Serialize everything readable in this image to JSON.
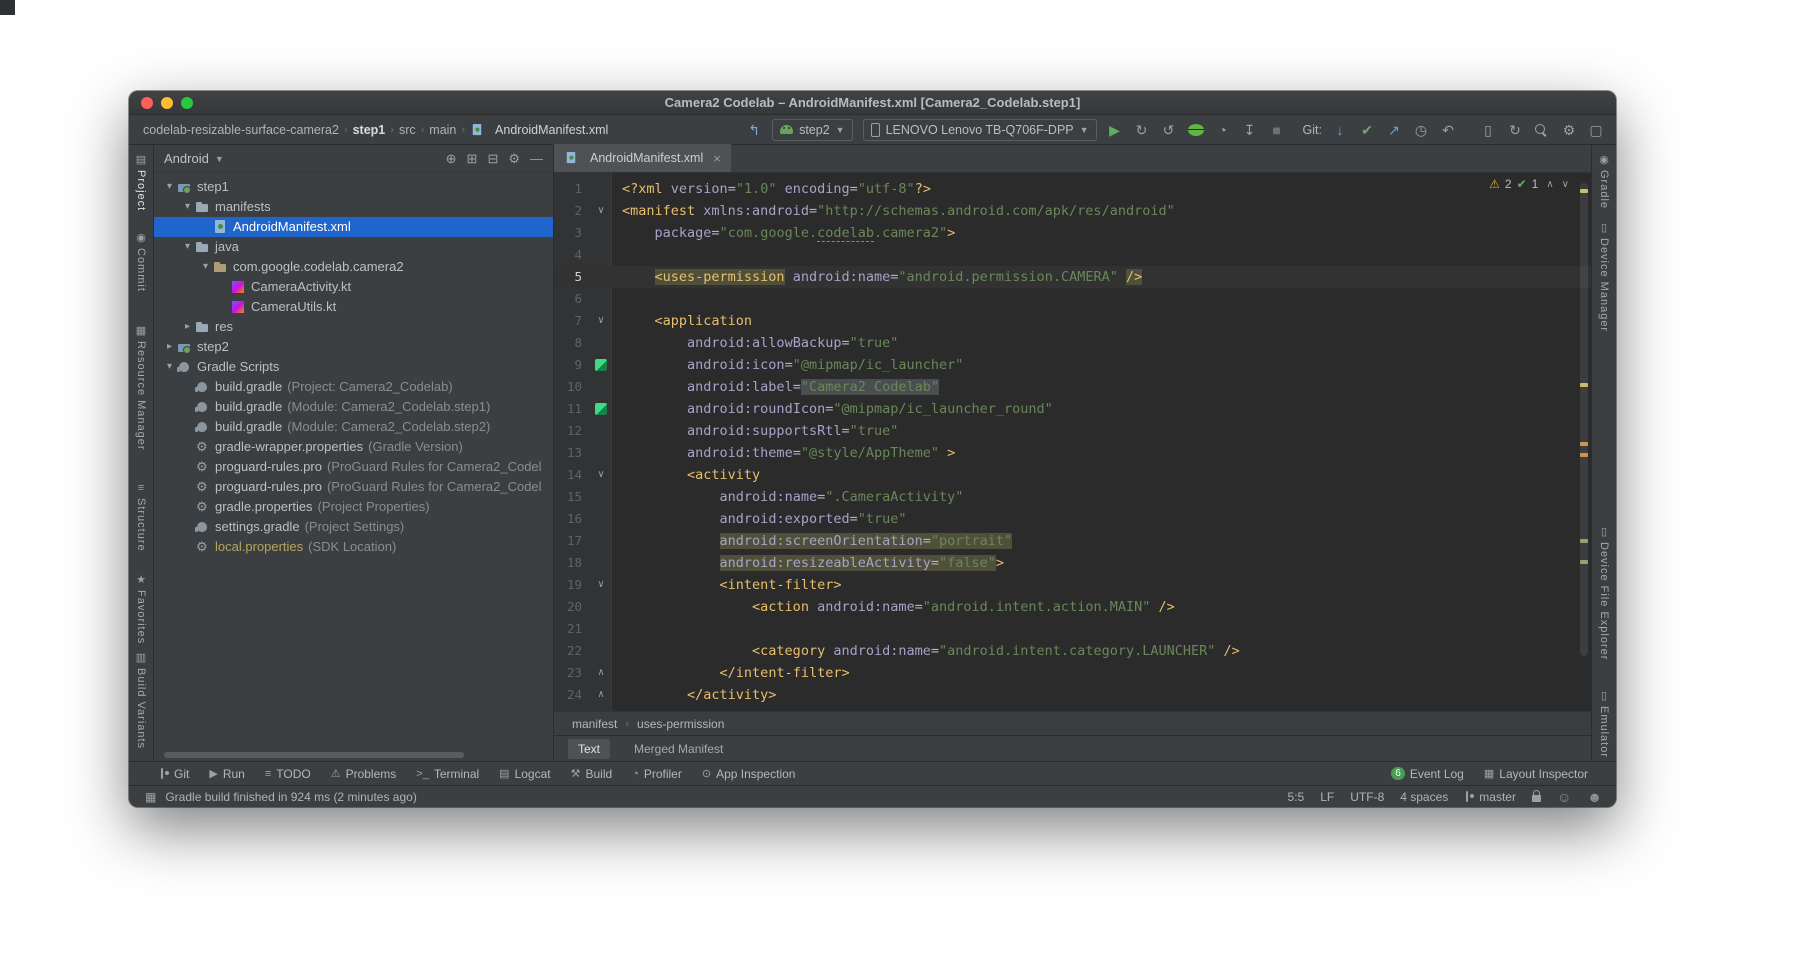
{
  "window": {
    "title": "Camera2 Codelab – AndroidManifest.xml [Camera2_Codelab.step1]"
  },
  "toolbar": {
    "breadcrumbs": [
      {
        "label": "codelab-resizable-surface-camera2"
      },
      {
        "label": "step1",
        "bold": true
      },
      {
        "label": "src"
      },
      {
        "label": "main"
      },
      {
        "label": "AndroidManifest.xml",
        "icon": "manifest",
        "bright": true
      }
    ],
    "back_icon": {
      "name": "back-arrow-icon",
      "glyph": "↰",
      "color": "#7da7d9"
    },
    "run_config": {
      "label": "step2"
    },
    "device": {
      "label": "LENOVO Lenovo TB-Q706F-DPP"
    },
    "run_icons": [
      {
        "name": "run-button",
        "glyph": "▶",
        "color": "#5fad65"
      },
      {
        "name": "apply-changes-button",
        "glyph": "↻",
        "color": "#9da0a3"
      },
      {
        "name": "apply-code-changes-button",
        "glyph": "↺",
        "color": "#9da0a3"
      },
      {
        "name": "debug-button",
        "css": "css-bug"
      },
      {
        "name": "profiler-button",
        "glyph": "◔",
        "color": "#9da0a3"
      },
      {
        "name": "attach-debugger-button",
        "glyph": "↧",
        "color": "#9da0a3"
      },
      {
        "name": "stop-button",
        "glyph": "■",
        "color": "#6e7173"
      }
    ],
    "git_label": "Git:",
    "git_icons": [
      {
        "name": "update-project-button",
        "glyph": "↓",
        "color": "#6a9fd8"
      },
      {
        "name": "commit-button",
        "glyph": "✔",
        "color": "#76a277"
      },
      {
        "name": "push-button",
        "glyph": "↗",
        "color": "#6a9fd8"
      },
      {
        "name": "history-button",
        "glyph": "◷",
        "color": "#9da0a3"
      },
      {
        "name": "rollback-button",
        "glyph": "↶",
        "color": "#9da0a3"
      }
    ],
    "right_icons": [
      {
        "name": "device-manager-icon",
        "glyph": "▯",
        "color": "#9da0a3"
      },
      {
        "name": "gradle-sync-icon",
        "glyph": "↻",
        "color": "#9da0a3"
      },
      {
        "name": "search-icon",
        "css": "css-search"
      },
      {
        "name": "settings-icon",
        "glyph": "⚙",
        "color": "#9da0a3"
      },
      {
        "name": "window-layout-icon",
        "glyph": "▢",
        "color": "#9da0a3"
      }
    ]
  },
  "left_stripe": {
    "items": [
      {
        "name": "project",
        "label": "Project",
        "icon": "▤",
        "active": true,
        "gap": 10
      },
      {
        "name": "commit",
        "label": "Commit",
        "icon": "◉",
        "gap": 22
      },
      {
        "name": "resource-manager",
        "label": "Resource Manager",
        "icon": "▦",
        "gap": 34
      },
      {
        "name": "structure",
        "label": "Structure",
        "icon": "≡",
        "gap": 32
      },
      {
        "name": "favorites",
        "label": "Favorites",
        "icon": "★",
        "gap": 24
      },
      {
        "name": "build-variants",
        "label": "Build Variants",
        "icon": "▥",
        "gap": 8
      }
    ]
  },
  "right_stripe": {
    "items": [
      {
        "name": "gradle",
        "label": "Gradle",
        "icon": "◉",
        "gap": 10
      },
      {
        "name": "device-manager",
        "label": "Device Manager",
        "icon": "▯",
        "gap": 14
      },
      {
        "name": "device-file-explorer",
        "label": "Device File Explorer",
        "icon": "▯",
        "gap": 195
      },
      {
        "name": "emulator",
        "label": "Emulator",
        "icon": "▯",
        "gap": 30
      }
    ]
  },
  "project_panel": {
    "view_selector": "Android",
    "header_icons": [
      {
        "name": "locate-file-icon",
        "glyph": "⊕"
      },
      {
        "name": "expand-all-icon",
        "glyph": "⊞"
      },
      {
        "name": "collapse-all-icon",
        "glyph": "⊟"
      },
      {
        "name": "panel-settings-icon",
        "glyph": "⚙"
      },
      {
        "name": "hide-panel-icon",
        "glyph": "—"
      }
    ],
    "tree": [
      {
        "label": "step1",
        "type": "module",
        "depth": 0,
        "chevron": "expanded"
      },
      {
        "label": "manifests",
        "type": "folder",
        "depth": 1,
        "chevron": "expanded"
      },
      {
        "label": "AndroidManifest.xml",
        "type": "manifest",
        "depth": 2,
        "selected": true
      },
      {
        "label": "java",
        "type": "folder",
        "depth": 1,
        "chevron": "expanded"
      },
      {
        "label": "com.google.codelab.camera2",
        "type": "package",
        "depth": 2,
        "chevron": "expanded"
      },
      {
        "label": "CameraActivity.kt",
        "type": "kotlin",
        "depth": 3
      },
      {
        "label": "CameraUtils.kt",
        "type": "kotlin",
        "depth": 3
      },
      {
        "label": "res",
        "type": "folder",
        "depth": 1,
        "chevron": "collapsed"
      },
      {
        "label": "step2",
        "type": "module",
        "depth": 0,
        "chevron": "collapsed"
      },
      {
        "label": "Gradle Scripts",
        "type": "gradle",
        "depth": 0,
        "chevron": "expanded"
      },
      {
        "label": "build.gradle",
        "sub": "(Project: Camera2_Codelab)",
        "type": "gradle",
        "depth": 1
      },
      {
        "label": "build.gradle",
        "sub": "(Module: Camera2_Codelab.step1)",
        "type": "gradle",
        "depth": 1
      },
      {
        "label": "build.gradle",
        "sub": "(Module: Camera2_Codelab.step2)",
        "type": "gradle",
        "depth": 1
      },
      {
        "label": "gradle-wrapper.properties",
        "sub": "(Gradle Version)",
        "type": "properties",
        "depth": 1
      },
      {
        "label": "proguard-rules.pro",
        "sub": "(ProGuard Rules for Camera2_Codel",
        "type": "proguard",
        "depth": 1
      },
      {
        "label": "proguard-rules.pro",
        "sub": "(ProGuard Rules for Camera2_Codel",
        "type": "proguard",
        "depth": 1
      },
      {
        "label": "gradle.properties",
        "sub": "(Project Properties)",
        "type": "properties",
        "depth": 1
      },
      {
        "label": "settings.gradle",
        "sub": "(Project Settings)",
        "type": "gradle",
        "depth": 1
      },
      {
        "label": "local.properties",
        "sub": "(SDK Location)",
        "type": "properties",
        "depth": 1,
        "cls": "warn"
      }
    ]
  },
  "editor": {
    "tab": "AndroidManifest.xml",
    "inspections": {
      "warning_count": "2",
      "ok_count": "1"
    },
    "breadcrumbs": [
      "manifest",
      "uses-permission"
    ],
    "bottom_tabs": [
      {
        "label": "Text",
        "active": true
      },
      {
        "label": "Merged Manifest"
      }
    ],
    "stripe_marks": [
      {
        "top": "3%",
        "color": "#d6bf55"
      },
      {
        "top": "39%",
        "color": "#d6bf55"
      },
      {
        "top": "50%",
        "color": "#e08f3c"
      },
      {
        "top": "52%",
        "color": "#e08f3c"
      },
      {
        "top": "68%",
        "color": "#9b9b6a"
      },
      {
        "top": "72%",
        "color": "#9b9b6a"
      }
    ],
    "lines": [
      {
        "n": 1,
        "s": [
          [
            "<?xml ",
            "t"
          ],
          [
            "version",
            "a"
          ],
          [
            "=",
            "p"
          ],
          [
            "\"1.0\"",
            "s"
          ],
          [
            " ",
            "p"
          ],
          [
            "encoding",
            "a"
          ],
          [
            "=",
            "p"
          ],
          [
            "\"utf-8\"",
            "s"
          ],
          [
            "?>",
            "t"
          ]
        ]
      },
      {
        "n": 2,
        "g": "f",
        "s": [
          [
            "<manifest ",
            "t"
          ],
          [
            "xmlns:android",
            "a"
          ],
          [
            "=",
            "p"
          ],
          [
            "\"http://schemas.android.com/apk/res/android\"",
            "s"
          ]
        ]
      },
      {
        "n": 3,
        "s": [
          [
            "    ",
            "p"
          ],
          [
            "package",
            "a"
          ],
          [
            "=",
            "p"
          ],
          [
            "\"com.google.",
            "s"
          ],
          [
            "codelab",
            "s y"
          ],
          [
            ".camera2\"",
            "s"
          ],
          [
            ">",
            "t"
          ]
        ]
      },
      {
        "n": 4,
        "s": []
      },
      {
        "n": 5,
        "cur": true,
        "s": [
          [
            "    ",
            "p"
          ],
          [
            "<uses-permission",
            "t h"
          ],
          [
            " ",
            "p"
          ],
          [
            "android:name",
            "a"
          ],
          [
            "=",
            "p"
          ],
          [
            "\"android.permission.CAMERA\"",
            "s"
          ],
          [
            " ",
            "p"
          ],
          [
            "/>",
            "t h"
          ]
        ]
      },
      {
        "n": 6,
        "s": []
      },
      {
        "n": 7,
        "g": "f",
        "s": [
          [
            "    ",
            "p"
          ],
          [
            "<application",
            "t"
          ]
        ]
      },
      {
        "n": 8,
        "s": [
          [
            "        ",
            "p"
          ],
          [
            "android:allowBackup",
            "a"
          ],
          [
            "=",
            "p"
          ],
          [
            "\"true\"",
            "s"
          ]
        ]
      },
      {
        "n": 9,
        "g": "i",
        "s": [
          [
            "        ",
            "p"
          ],
          [
            "android:icon",
            "a"
          ],
          [
            "=",
            "p"
          ],
          [
            "\"@mipmap/ic_launcher\"",
            "s"
          ]
        ]
      },
      {
        "n": 10,
        "s": [
          [
            "        ",
            "p"
          ],
          [
            "android:label",
            "a"
          ],
          [
            "=",
            "p"
          ],
          [
            "\"Camera2 Codelab\"",
            "s h2"
          ]
        ]
      },
      {
        "n": 11,
        "g": "i",
        "s": [
          [
            "        ",
            "p"
          ],
          [
            "android:roundIcon",
            "a"
          ],
          [
            "=",
            "p"
          ],
          [
            "\"@mipmap/ic_launcher_round\"",
            "s"
          ]
        ]
      },
      {
        "n": 12,
        "s": [
          [
            "        ",
            "p"
          ],
          [
            "android:supportsRtl",
            "a"
          ],
          [
            "=",
            "p"
          ],
          [
            "\"true\"",
            "s"
          ]
        ]
      },
      {
        "n": 13,
        "s": [
          [
            "        ",
            "p"
          ],
          [
            "android:theme",
            "a"
          ],
          [
            "=",
            "p"
          ],
          [
            "\"@style/AppTheme\"",
            "s"
          ],
          [
            " >",
            "t"
          ]
        ]
      },
      {
        "n": 14,
        "g": "f",
        "s": [
          [
            "        ",
            "p"
          ],
          [
            "<activity",
            "t"
          ]
        ]
      },
      {
        "n": 15,
        "s": [
          [
            "            ",
            "p"
          ],
          [
            "android:name",
            "a"
          ],
          [
            "=",
            "p"
          ],
          [
            "\".CameraActivity\"",
            "s"
          ]
        ]
      },
      {
        "n": 16,
        "s": [
          [
            "            ",
            "p"
          ],
          [
            "android:exported",
            "a"
          ],
          [
            "=",
            "p"
          ],
          [
            "\"true\"",
            "s"
          ]
        ]
      },
      {
        "n": 17,
        "s": [
          [
            "            ",
            "p"
          ],
          [
            "android:screenOrientation",
            "a h"
          ],
          [
            "=",
            "p h"
          ],
          [
            "\"portrait\"",
            "s h"
          ]
        ]
      },
      {
        "n": 18,
        "s": [
          [
            "            ",
            "p"
          ],
          [
            "android:resizeableActivity",
            "a h"
          ],
          [
            "=",
            "p h"
          ],
          [
            "\"false\"",
            "s h"
          ],
          [
            ">",
            "t"
          ]
        ]
      },
      {
        "n": 19,
        "g": "f",
        "s": [
          [
            "            ",
            "p"
          ],
          [
            "<intent-filter>",
            "t"
          ]
        ]
      },
      {
        "n": 20,
        "s": [
          [
            "                ",
            "p"
          ],
          [
            "<action ",
            "t"
          ],
          [
            "android:name",
            "a"
          ],
          [
            "=",
            "p"
          ],
          [
            "\"android.intent.action.MAIN\"",
            "s"
          ],
          [
            " />",
            "t"
          ]
        ]
      },
      {
        "n": 21,
        "s": []
      },
      {
        "n": 22,
        "s": [
          [
            "                ",
            "p"
          ],
          [
            "<category ",
            "t"
          ],
          [
            "android:name",
            "a"
          ],
          [
            "=",
            "p"
          ],
          [
            "\"android.intent.category.LAUNCHER\"",
            "s"
          ],
          [
            " />",
            "t"
          ]
        ]
      },
      {
        "n": 23,
        "g": "e",
        "s": [
          [
            "            ",
            "p"
          ],
          [
            "</intent-filter>",
            "t"
          ]
        ]
      },
      {
        "n": 24,
        "g": "e",
        "s": [
          [
            "        ",
            "p"
          ],
          [
            "</activity>",
            "t"
          ]
        ]
      }
    ]
  },
  "bottom_bar": {
    "left": [
      {
        "label": "Git",
        "icon": "branch"
      },
      {
        "label": "Run",
        "icon": "▶"
      },
      {
        "label": "TODO",
        "icon": "≡"
      },
      {
        "label": "Problems",
        "icon": "⚠"
      },
      {
        "label": "Terminal",
        "icon": ">_"
      },
      {
        "label": "Logcat",
        "icon": "▤"
      },
      {
        "label": "Build",
        "icon": "⚒"
      },
      {
        "label": "Profiler",
        "icon": "◔"
      },
      {
        "label": "App Inspection",
        "icon": "⊙"
      }
    ],
    "right": [
      {
        "label": "Event Log",
        "badge": "6"
      },
      {
        "label": "Layout Inspector",
        "icon": "▦"
      }
    ]
  },
  "status_bar": {
    "message": "Gradle build finished in 924 ms (2 minutes ago)",
    "items": [
      {
        "name": "caret-position",
        "text": "5:5"
      },
      {
        "name": "line-ending",
        "text": "LF"
      },
      {
        "name": "file-encoding",
        "text": "UTF-8"
      },
      {
        "name": "indent-style",
        "text": "4 spaces"
      },
      {
        "name": "git-branch",
        "text": "master",
        "icon": "branch"
      }
    ]
  }
}
